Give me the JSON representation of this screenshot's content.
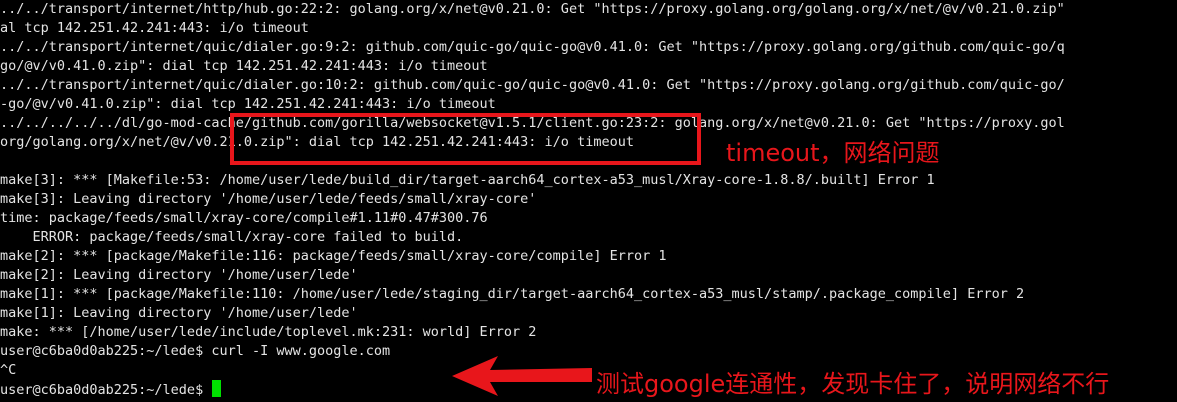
{
  "terminal": {
    "lines": [
      "../../transport/internet/http/hub.go:22:2: golang.org/x/net@v0.21.0: Get \"https://proxy.golang.org/golang.org/x/net/@v/v0.21.0.zip\"",
      "al tcp 142.251.42.241:443: i/o timeout",
      "../../transport/internet/quic/dialer.go:9:2: github.com/quic-go/quic-go@v0.41.0: Get \"https://proxy.golang.org/github.com/quic-go/q",
      "go/@v/v0.41.0.zip\": dial tcp 142.251.42.241:443: i/o timeout",
      "../../transport/internet/quic/dialer.go:10:2: github.com/quic-go/quic-go@v0.41.0: Get \"https://proxy.golang.org/github.com/quic-go/",
      "-go/@v/v0.41.0.zip\": dial tcp 142.251.42.241:443: i/o timeout",
      "../../../../../dl/go-mod-cache/github.com/gorilla/websocket@v1.5.1/client.go:23:2: golang.org/x/net@v0.21.0: Get \"https://proxy.gol",
      "org/golang.org/x/net/@v/v0.21.0.zip\": dial tcp 142.251.42.241:443: i/o timeout",
      "",
      "make[3]: *** [Makefile:53: /home/user/lede/build_dir/target-aarch64_cortex-a53_musl/Xray-core-1.8.8/.built] Error 1",
      "make[3]: Leaving directory '/home/user/lede/feeds/small/xray-core'",
      "time: package/feeds/small/xray-core/compile#1.11#0.47#300.76",
      "    ERROR: package/feeds/small/xray-core failed to build.",
      "make[2]: *** [package/Makefile:116: package/feeds/small/xray-core/compile] Error 1",
      "make[2]: Leaving directory '/home/user/lede'",
      "make[1]: *** [package/Makefile:110: /home/user/lede/staging_dir/target-aarch64_cortex-a53_musl/stamp/.package_compile] Error 2",
      "make[1]: Leaving directory '/home/user/lede'",
      "make: *** [/home/user/lede/include/toplevel.mk:231: world] Error 2",
      "user@c6ba0d0ab225:~/lede$ curl -I www.google.com",
      "^C",
      "user@c6ba0d0ab225:~/lede$ "
    ]
  },
  "annotations": {
    "timeout_note": "timeout，网络问题",
    "curl_note": "测试google连通性，发现卡住了，说明网络不行"
  },
  "colors": {
    "background": "#000000",
    "text": "#e4e4e4",
    "annotation": "#e8161b",
    "cursor": "#00e000"
  }
}
